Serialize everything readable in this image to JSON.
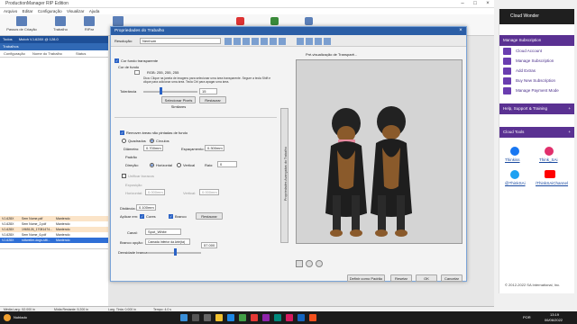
{
  "app": {
    "title": "ProductionManager RIP Edition",
    "menu": [
      "Arquivo",
      "Editar",
      "Configuração",
      "Visualizar",
      "Ajuda"
    ],
    "ribbon": [
      "Passos de Criação",
      "Trabalho",
      "RIPar",
      "Imprimir"
    ]
  },
  "left": {
    "tab_main": "Todos",
    "tab_printer": "Mutoh VJ-628X @ 128.0",
    "tab_sub": "Trabalhos",
    "cols": [
      "Configuração",
      "Nome do Trabalho",
      "Status"
    ],
    "jobs": [
      {
        "id": "VJ-628X",
        "name": "Sem Nome.pdf",
        "status": "Mantendo"
      },
      {
        "id": "VJ-628X",
        "name": "Sem Nome_2.pdf",
        "status": "Mantendo"
      },
      {
        "id": "VJ-628X",
        "name": "1965126_17081474...",
        "status": "Mantendo"
      },
      {
        "id": "VJ-628X",
        "name": "Sem Nome_6.pdf",
        "status": "Mantendo"
      },
      {
        "id": "VJ-628X",
        "name": "rottweiler-dogs-sitt...",
        "status": "Mantendo"
      }
    ]
  },
  "status": {
    "media": "Média Larg.: 52.000 in",
    "width": "Mídia Restante: 5.200 in",
    "dpi": "Larg. Tinta: 0.000 in",
    "extra": "Tempo: 4.0 s"
  },
  "dialog": {
    "title": "Propriedades do Trabalho",
    "resolution_label": "Resolução:",
    "resolution_value": "Nenhum",
    "transparent_label": "Cor fundo transparente",
    "bg_label": "Cor de fundo",
    "rgb": "RGB: 255, 255, 255",
    "hint": "Dica: Clique na janela de imagens para selecionar uma área transparente. Segure a tecla Shift e clique para adicionar uma área. Tecla Ctrl para apagar uma área.",
    "tolerance_label": "Tolerância",
    "tolerance_value": "15",
    "select_btn": "Selecionar Pixels Similares",
    "restore_btn": "Restaurar",
    "remove_label": "Remover áreas não pintadas de fundo",
    "quad_label": "Quadrados",
    "circ_label": "Círculos",
    "diam_label": "Diâmetro:",
    "diam_value": "0.700mm",
    "spacing_label": "Espaçamento:",
    "spacing_value": "0.300mm",
    "pattern_label": "Padrão",
    "dir_label": "Direção:",
    "horiz": "Horizontal",
    "vert": "Vertical",
    "ratio_label": "Raio:",
    "ratio_value": "0",
    "union_label": "Unificar buracos",
    "exposure_label": "Exposição",
    "horiz2_label": "Horizontal:",
    "horiz2_value": "0.000mm",
    "vert2_label": "Vertical:",
    "vert2_value": "0.000mm",
    "distance_label": "Distância:",
    "distance_value": "0.100mm",
    "apply_label": "Aplicar em:",
    "cores_label": "Cores",
    "white_label": "Branco",
    "restore2_btn": "Restaurar",
    "channel_label": "Canal:",
    "channel_value": "Spot_White",
    "white_option_label": "Branco opção:",
    "white_option_value": "Camada Inferior da Arte(ta)",
    "white_option_num": "57.000",
    "density_label": "Densidade branca:",
    "preview_label": "Pré-visualização de Transparê...",
    "side_tab": "Propriedades Avançadas do Trabalho",
    "defaults_btn": "Definir como Padrão",
    "reset_btn": "Resetar",
    "ok_btn": "OK",
    "cancel_btn": "Cancelar"
  },
  "sidebar": {
    "brand": "Cloud Wonder",
    "sec1": "Manage Subscription",
    "items": [
      "Cloud Account",
      "Manage Subscription",
      "Add Extras",
      "Buy New Subscription",
      "Manage Payment Mode"
    ],
    "sec2": "Help, Support & Training",
    "sec3": "Cloud Tools",
    "social": [
      "Thinkiss",
      "Think_SAi",
      "@ThinkSAi",
      "/ThinkSAiChannel"
    ],
    "footer": "© 2012-2022 SA International, Inc."
  },
  "taskbar": {
    "time": "13:19",
    "date": "06/06/2022",
    "lang": "POR",
    "weather": "Nublado"
  },
  "colors": {
    "accent": "#2b5ea6",
    "sidebar_purple": "#5a3192",
    "job_selected": "#2f6fd6"
  }
}
